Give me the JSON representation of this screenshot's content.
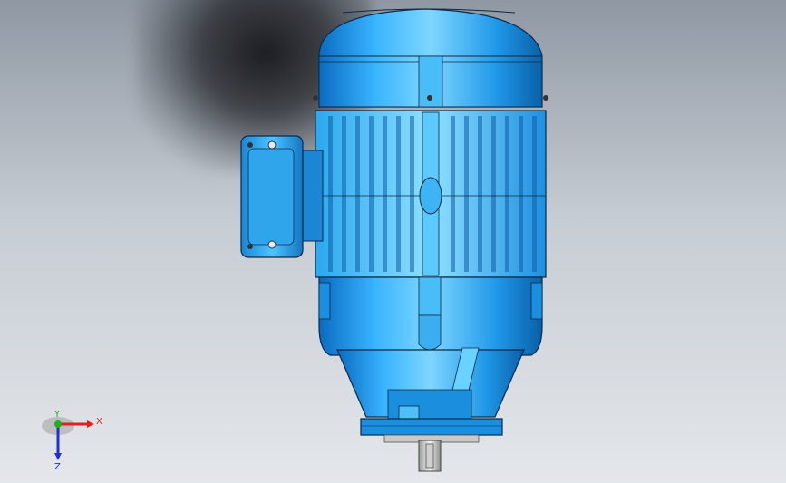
{
  "viewport": {
    "colors": {
      "body": "#1a8fe0",
      "body_light": "#4fc0ff",
      "body_dark": "#0a5fa8",
      "outline": "#0b2a45",
      "shaft": "#d8d8d8"
    }
  },
  "triad": {
    "x_label": "X",
    "y_label": "Y",
    "z_label": "Z",
    "colors": {
      "x": "#e02020",
      "y": "#20b020",
      "z": "#2030d0"
    }
  }
}
